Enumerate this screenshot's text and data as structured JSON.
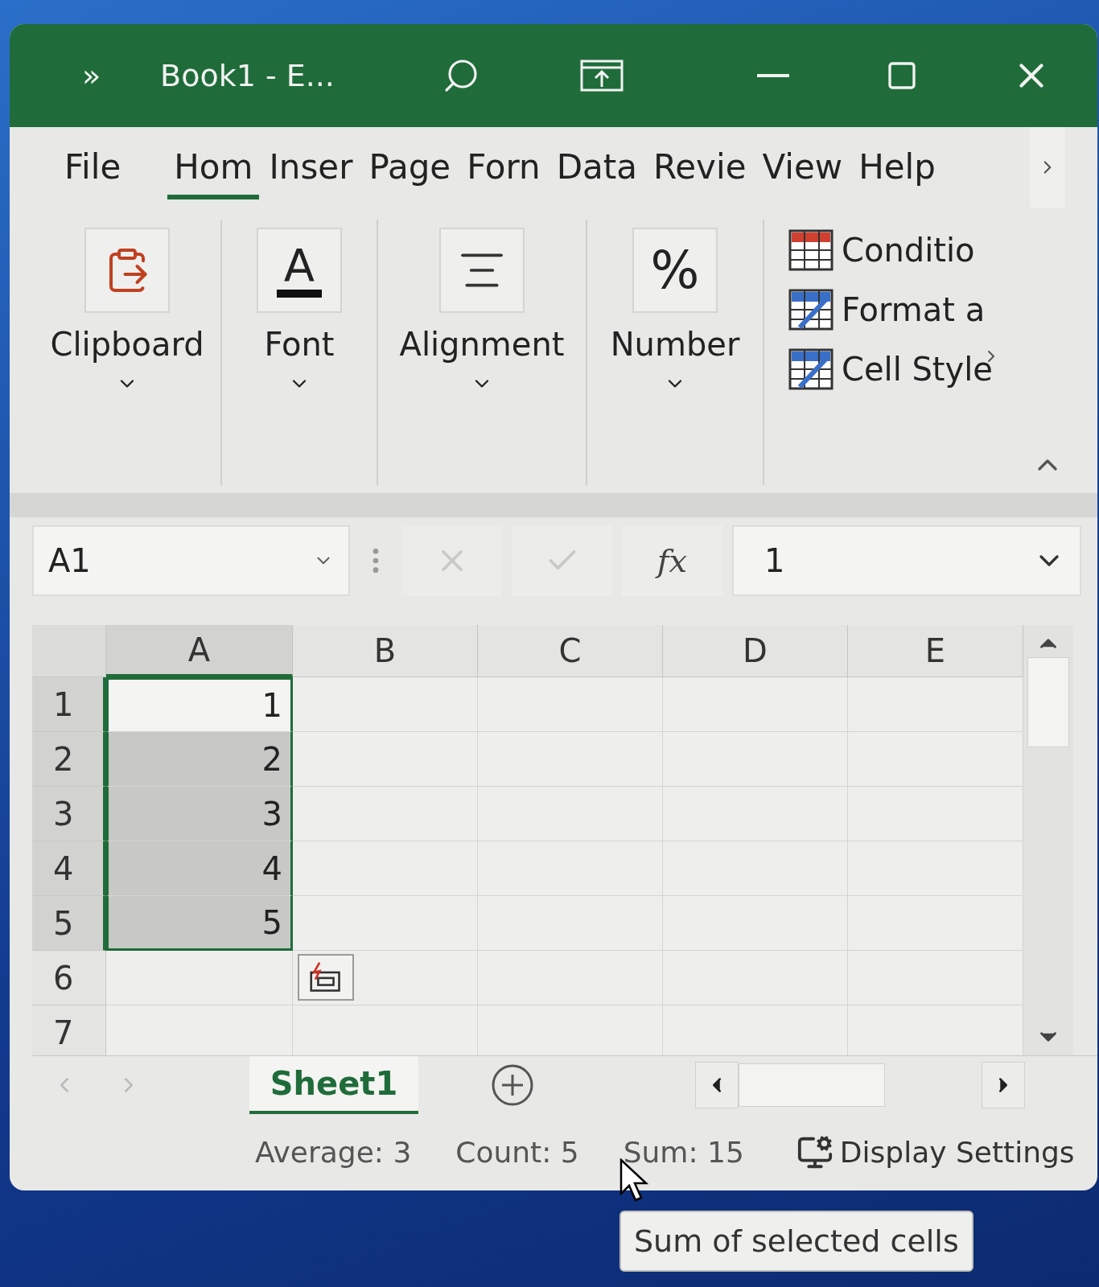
{
  "title_bar": {
    "overflow": "»",
    "title": "Book1  -  E..."
  },
  "ribbon_tabs": [
    {
      "label": "File",
      "selected": false
    },
    {
      "label": "Hom",
      "selected": true
    },
    {
      "label": "Inser",
      "selected": false
    },
    {
      "label": "Page",
      "selected": false
    },
    {
      "label": "Forn",
      "selected": false
    },
    {
      "label": "Data",
      "selected": false
    },
    {
      "label": "Revie",
      "selected": false
    },
    {
      "label": "View",
      "selected": false
    },
    {
      "label": "Help",
      "selected": false
    }
  ],
  "ribbon_groups": [
    {
      "kind": "clipboard",
      "label": "Clipboard"
    },
    {
      "kind": "font",
      "label": "Font",
      "glyph": "A"
    },
    {
      "kind": "alignment",
      "label": "Alignment"
    },
    {
      "kind": "number",
      "label": "Number",
      "glyph": "%"
    }
  ],
  "styles_group": [
    {
      "kind": "conditional",
      "label": "Conditio"
    },
    {
      "kind": "table",
      "label": "Format a"
    },
    {
      "kind": "cell",
      "label": "Cell Style"
    }
  ],
  "formula_bar": {
    "name_box": "A1",
    "function_glyph": "fx",
    "value": "1"
  },
  "grid": {
    "columns": [
      {
        "label": "A",
        "selected": true
      },
      {
        "label": "B",
        "selected": false
      },
      {
        "label": "C",
        "selected": false
      },
      {
        "label": "D",
        "selected": false
      },
      {
        "label": "E",
        "selected": false
      }
    ],
    "rows": [
      {
        "header": "1",
        "value": "1",
        "selected": true,
        "active": true
      },
      {
        "header": "2",
        "value": "2",
        "selected": true,
        "active": false
      },
      {
        "header": "3",
        "value": "3",
        "selected": true,
        "active": false
      },
      {
        "header": "4",
        "value": "4",
        "selected": true,
        "active": false
      },
      {
        "header": "5",
        "value": "5",
        "selected": true,
        "active": false
      },
      {
        "header": "6",
        "selected": false,
        "active": false
      },
      {
        "header": "7",
        "selected": false,
        "active": false
      }
    ]
  },
  "sheet_tabs": [
    {
      "label": "Sheet1",
      "selected": true
    }
  ],
  "status_bar": {
    "items": [
      "Average: 3",
      "Count: 5",
      "Sum: 15"
    ],
    "display_settings": "Display Settings"
  },
  "tooltip": "Sum of selected cells"
}
